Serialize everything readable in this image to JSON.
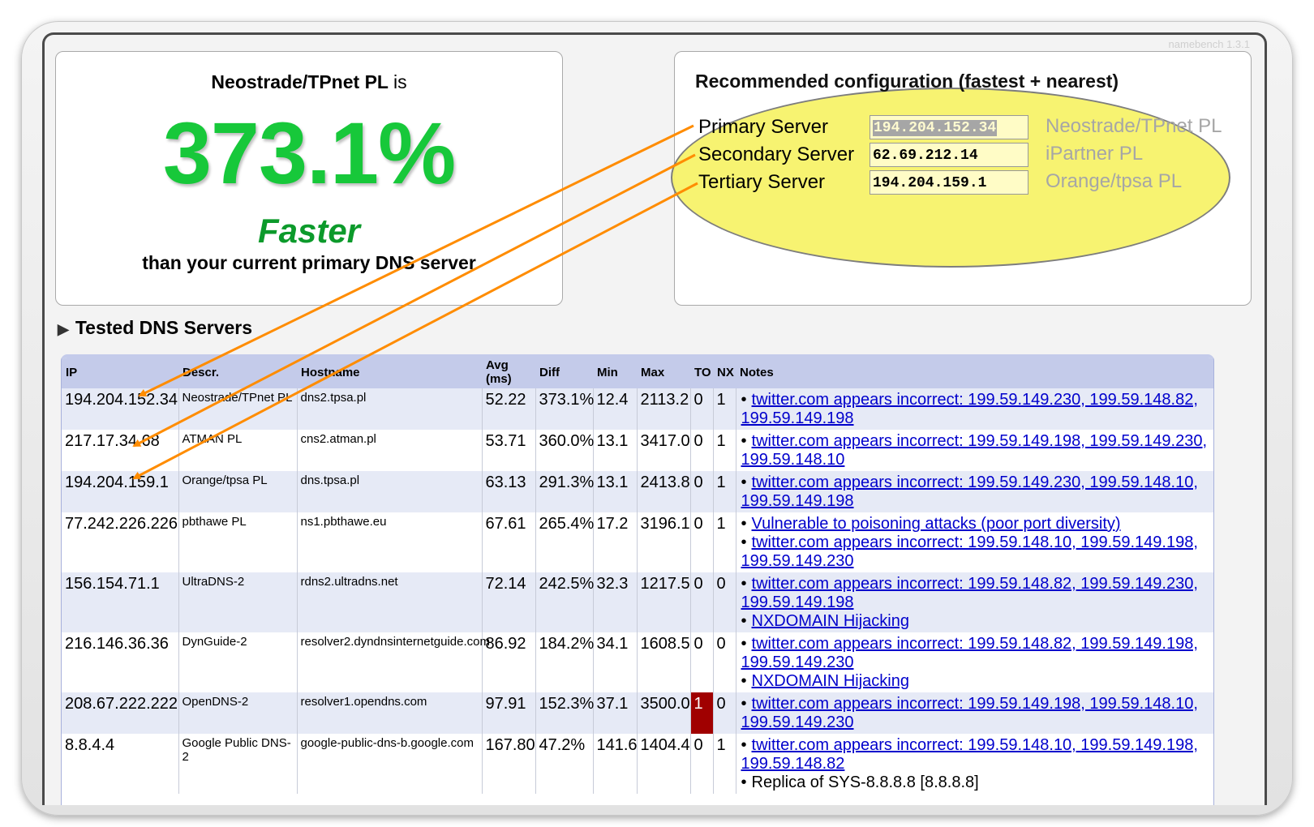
{
  "app": {
    "version": "namebench 1.3.1"
  },
  "summary": {
    "provider": "Neostrade/TPnet PL",
    "is_text": "is",
    "percent": "373.1%",
    "faster": "Faster",
    "than": "than your current primary DNS server"
  },
  "recommended": {
    "title": "Recommended configuration (fastest + nearest)",
    "servers": [
      {
        "label": "Primary Server",
        "ip": "194.204.152.34",
        "desc": "Neostrade/TPnet PL"
      },
      {
        "label": "Secondary Server",
        "ip": "62.69.212.14",
        "desc": "iPartner PL"
      },
      {
        "label": "Tertiary Server",
        "ip": "194.204.159.1",
        "desc": "Orange/tpsa PL"
      }
    ]
  },
  "tested": {
    "title": "Tested DNS Servers",
    "headers": [
      "IP",
      "Descr.",
      "Hostname",
      "Avg (ms)",
      "Diff",
      "Min",
      "Max",
      "TO",
      "NX",
      "Notes"
    ],
    "rows": [
      {
        "ip": "194.204.152.34",
        "descr": "Neostrade/TPnet PL",
        "hostname": "dns2.tpsa.pl",
        "avg": "52.22",
        "diff": "373.1%",
        "min": "12.4",
        "max": "2113.2",
        "to": "0",
        "nx": "1",
        "notes": [
          "twitter.com appears incorrect: 199.59.149.230, 199.59.148.82, 199.59.149.198"
        ]
      },
      {
        "ip": "217.17.34.68",
        "descr": "ATMAN PL",
        "hostname": "cns2.atman.pl",
        "avg": "53.71",
        "diff": "360.0%",
        "min": "13.1",
        "max": "3417.0",
        "to": "0",
        "nx": "1",
        "notes": [
          "twitter.com appears incorrect: 199.59.149.198, 199.59.149.230, 199.59.148.10"
        ]
      },
      {
        "ip": "194.204.159.1",
        "descr": "Orange/tpsa PL",
        "hostname": "dns.tpsa.pl",
        "avg": "63.13",
        "diff": "291.3%",
        "min": "13.1",
        "max": "2413.8",
        "to": "0",
        "nx": "1",
        "notes": [
          "twitter.com appears incorrect: 199.59.149.230, 199.59.148.10, 199.59.149.198"
        ]
      },
      {
        "ip": "77.242.226.226",
        "descr": "pbthawe PL",
        "hostname": "ns1.pbthawe.eu",
        "avg": "67.61",
        "diff": "265.4%",
        "min": "17.2",
        "max": "3196.1",
        "to": "0",
        "nx": "1",
        "notes": [
          "Vulnerable to poisoning attacks (poor port diversity)",
          "twitter.com appears incorrect: 199.59.148.10, 199.59.149.198, 199.59.149.230"
        ]
      },
      {
        "ip": "156.154.71.1",
        "descr": "UltraDNS-2",
        "hostname": "rdns2.ultradns.net",
        "avg": "72.14",
        "diff": "242.5%",
        "min": "32.3",
        "max": "1217.5",
        "to": "0",
        "nx": "0",
        "notes": [
          "twitter.com appears incorrect: 199.59.148.82, 199.59.149.230, 199.59.149.198",
          "NXDOMAIN Hijacking"
        ]
      },
      {
        "ip": "216.146.36.36",
        "descr": "DynGuide-2",
        "hostname": "resolver2.dyndnsinternetguide.com",
        "avg": "86.92",
        "diff": "184.2%",
        "min": "34.1",
        "max": "1608.5",
        "to": "0",
        "nx": "0",
        "notes": [
          "twitter.com appears incorrect: 199.59.148.82, 199.59.149.198, 199.59.149.230",
          "NXDOMAIN Hijacking"
        ]
      },
      {
        "ip": "208.67.222.222",
        "descr": "OpenDNS-2",
        "hostname": "resolver1.opendns.com",
        "avg": "97.91",
        "diff": "152.3%",
        "min": "37.1",
        "max": "3500.0",
        "to": "1",
        "nx": "0",
        "notes": [
          "twitter.com appears incorrect: 199.59.149.198, 199.59.148.10, 199.59.149.230"
        ]
      },
      {
        "ip": "8.8.4.4",
        "descr": "Google Public DNS-2",
        "hostname": "google-public-dns-b.google.com",
        "avg": "167.80",
        "diff": "47.2%",
        "min": "141.6",
        "max": "1404.4",
        "to": "0",
        "nx": "1",
        "notes": [
          "twitter.com appears incorrect: 199.59.148.10, 199.59.149.198, 199.59.148.82",
          "Replica of SYS-8.8.8.8 [8.8.8.8]"
        ]
      }
    ]
  },
  "colors": {
    "percent": "#17c83a",
    "faster": "#0c9a2b",
    "arrow": "#ff8c00",
    "highlight": "#f7f36a",
    "timeout": "#a00000"
  }
}
